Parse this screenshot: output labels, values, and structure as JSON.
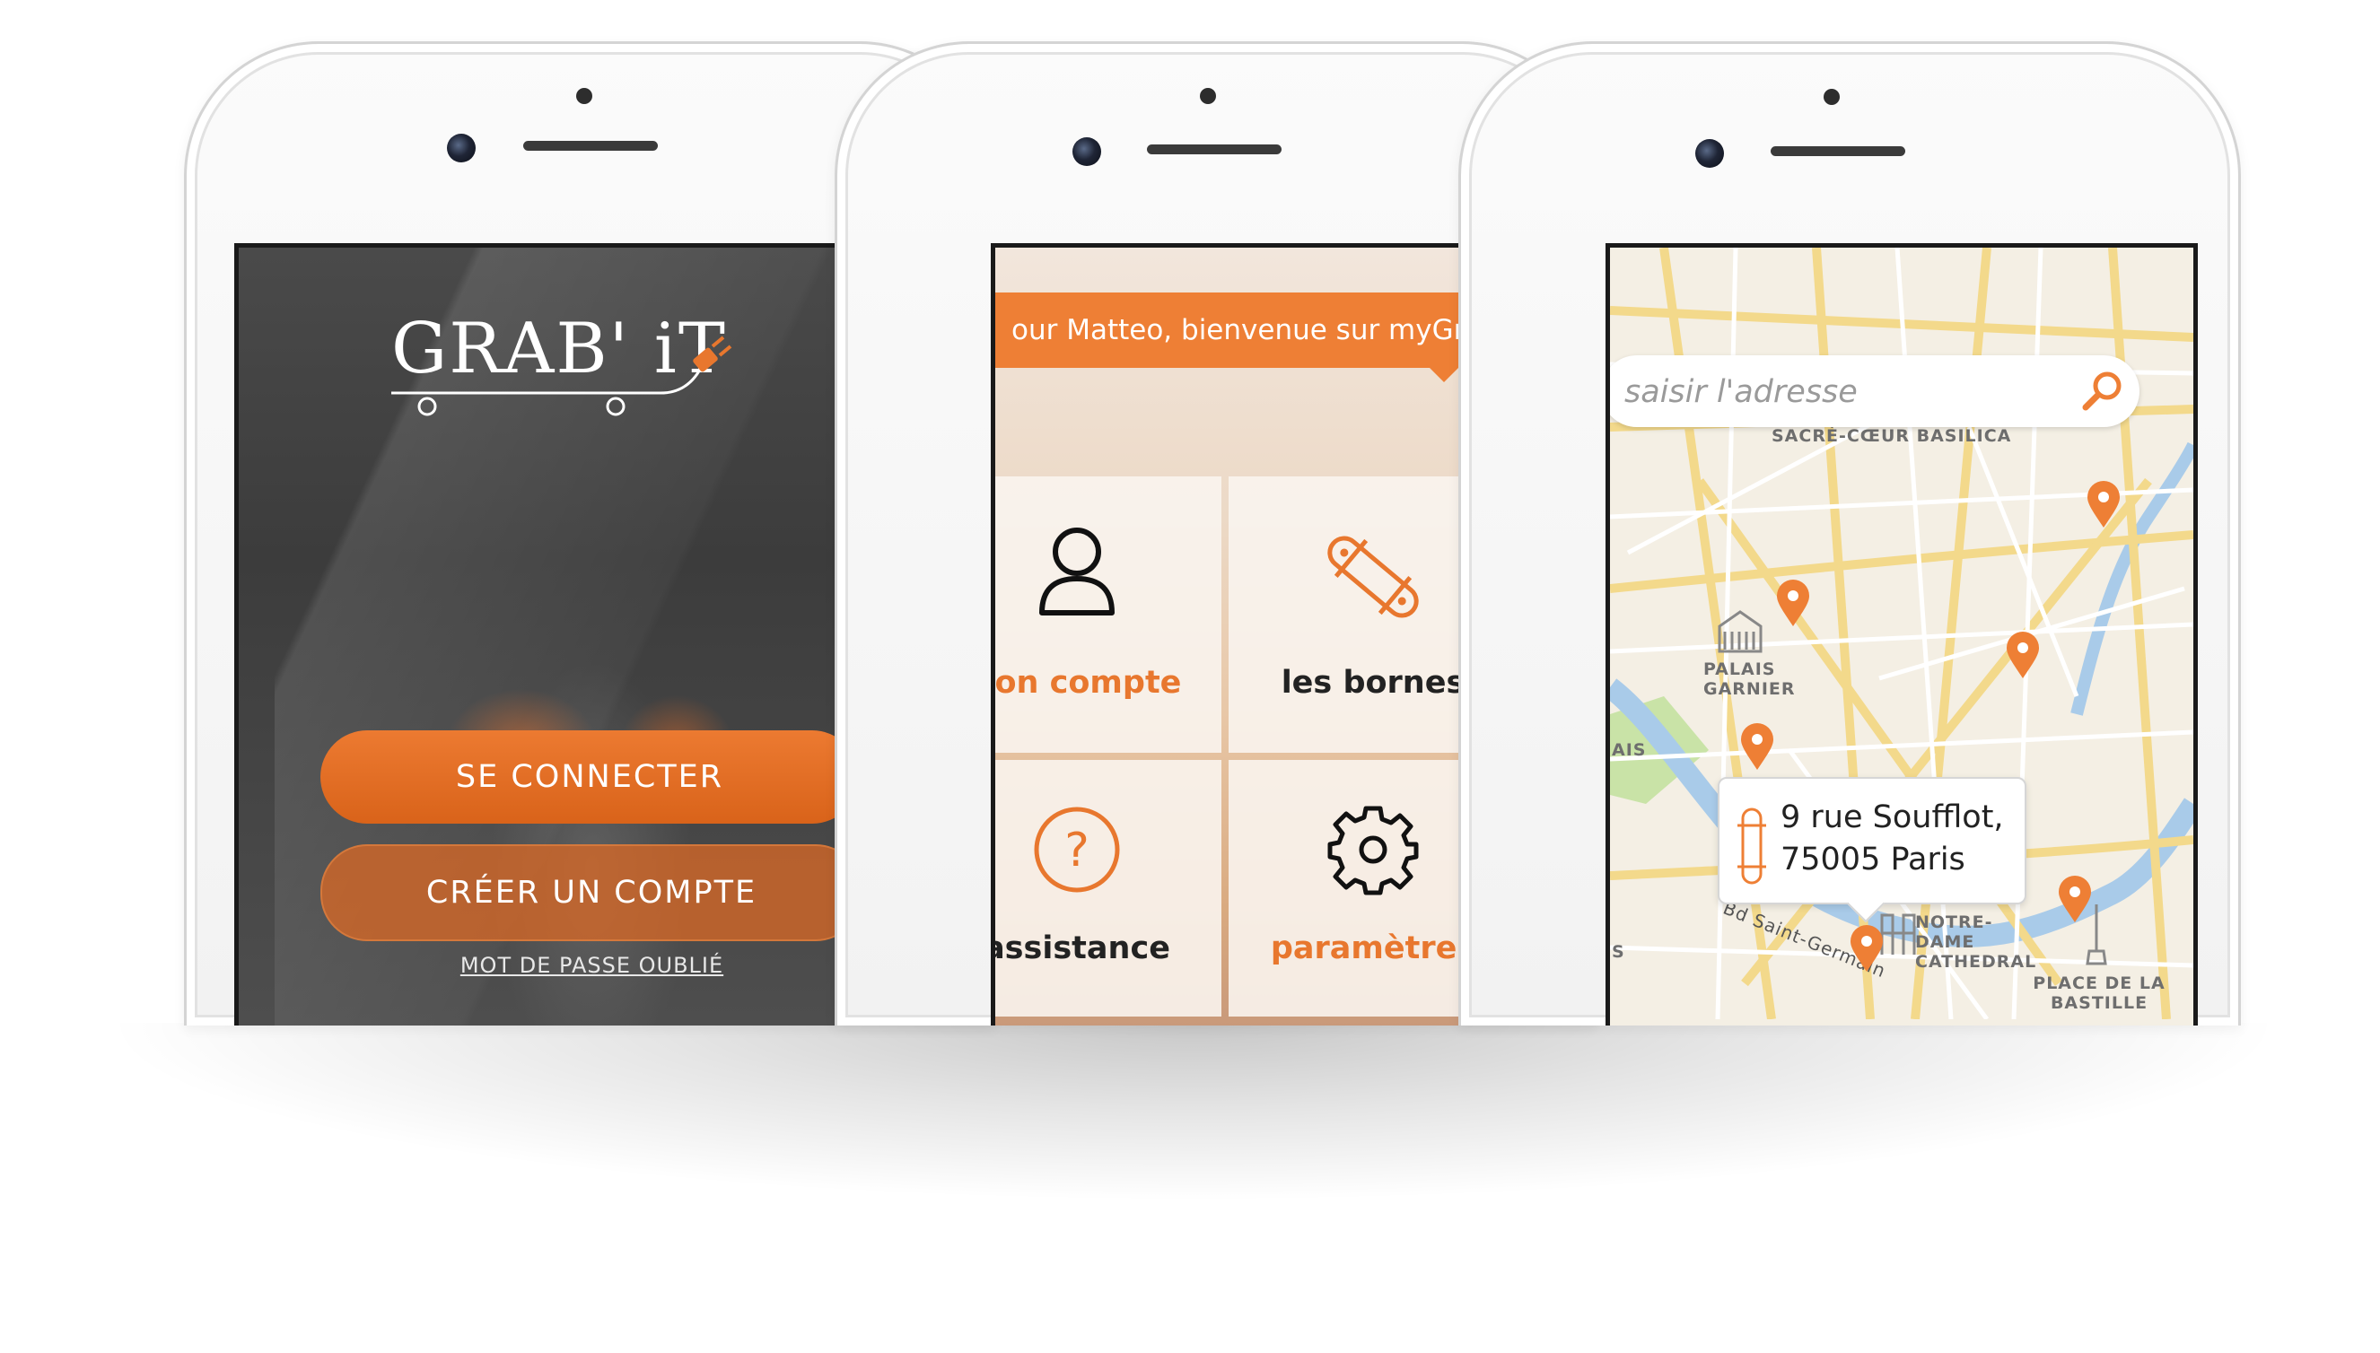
{
  "colors": {
    "accent": "#ee7f35",
    "accent_dark": "#d9631a",
    "text_dark": "#222222"
  },
  "login_screen": {
    "logo_text": "GRAB' iT",
    "primary_button": "SE CONNECTER",
    "secondary_button": "CRÉER UN COMPTE",
    "forgot_link": "MOT DE PASSE OUBLIÉ"
  },
  "menu_screen": {
    "greeting": "our Matteo, bienvenue sur myGrab'it.",
    "tiles": [
      {
        "label": "non compte",
        "icon": "user-icon"
      },
      {
        "label": "les bornes",
        "icon": "skateboard-icon"
      },
      {
        "label": "assistance",
        "icon": "help-icon"
      },
      {
        "label": "paramètres",
        "icon": "gear-icon"
      }
    ]
  },
  "map_screen": {
    "search_placeholder": "saisir l'adresse",
    "search_icon": "search-icon",
    "labels": {
      "sacre_coeur": "SACRÉ-CŒUR BASILICA",
      "palais_garnier": "PALAIS GARNIER",
      "notre_dame": "NOTRE-DAME CATHEDRAL",
      "bastille": "PLACE DE LA BASTILLE",
      "street": "Bd Saint-Germain",
      "edge_ais": "AIS",
      "edge_s": "S"
    },
    "callout": {
      "line1": "9 rue Soufflot,",
      "line2": "75005 Paris",
      "icon": "skateboard-icon"
    },
    "pin_count": 7
  }
}
